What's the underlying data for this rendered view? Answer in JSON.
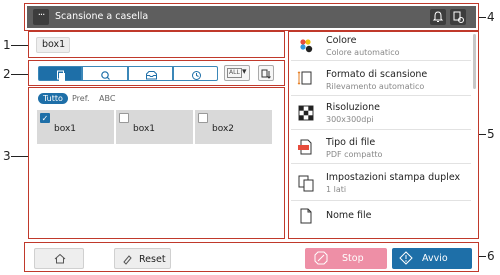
{
  "header": {
    "title": "Scansione a casella",
    "menu_icon": "ellipsis-icon",
    "menu_glyph": "···",
    "notification_icon": "bell-icon",
    "job_icon": "job-list-icon"
  },
  "box_field": {
    "value": "box1"
  },
  "toolbar": {
    "buttons": [
      {
        "icon": "box-list-icon",
        "active": true
      },
      {
        "icon": "search-icon",
        "active": false
      },
      {
        "icon": "inbox-icon",
        "active": false
      },
      {
        "icon": "clock-icon",
        "active": false
      }
    ],
    "filter_dropdown": {
      "label": "ALL",
      "caret": "▾"
    },
    "sort_icon": "sort-icon"
  },
  "filter_tabs": [
    {
      "label": "Tutto",
      "active": true
    },
    {
      "label": "Pref.",
      "active": false
    },
    {
      "label": "ABC",
      "active": false
    }
  ],
  "boxes": [
    {
      "label": "box1",
      "checked": true
    },
    {
      "label": "box1",
      "checked": false
    },
    {
      "label": "box2",
      "checked": false
    }
  ],
  "check_glyph": "✓",
  "settings": [
    {
      "icon": "color-icon",
      "name": "Colore",
      "value": "Colore automatico"
    },
    {
      "icon": "scan-size-icon",
      "name": "Formato di scansione",
      "value": "Rilevamento automatico"
    },
    {
      "icon": "resolution-icon",
      "name": "Risoluzione",
      "value": "300x300dpi"
    },
    {
      "icon": "pdf-file-icon",
      "name": "Tipo di file",
      "value": "PDF compatto"
    },
    {
      "icon": "duplex-icon",
      "name": "Impostazioni stampa duplex",
      "value": "1 lati"
    },
    {
      "icon": "file-name-icon",
      "name": "Nome file",
      "value": ""
    }
  ],
  "bottom": {
    "home_icon": "home-icon",
    "reset_label": "Reset",
    "reset_icon": "eraser-icon",
    "stop_label": "Stop",
    "stop_icon": "stop-icon",
    "start_label": "Avvio",
    "start_icon": "start-icon"
  },
  "callouts": [
    "1",
    "2",
    "3",
    "4",
    "5",
    "6"
  ],
  "colors": {
    "accent": "#1e6fa8",
    "frame": "#c0392b",
    "header_bg": "#5e5e5e",
    "stop": "#ee8fa6"
  }
}
